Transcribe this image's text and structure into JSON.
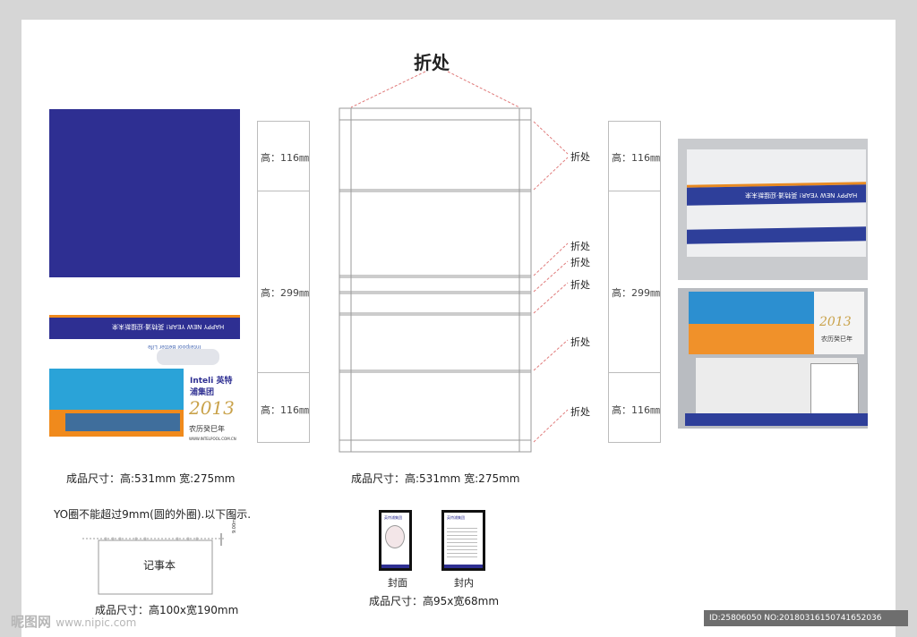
{
  "header": {
    "fold_title": "折处"
  },
  "design_front": {
    "band_text": "HAPPY NEW YEAR! 英特浦·迎接新未来",
    "sub_text": "Intelpool Better Life",
    "brand": "Inteli 英特浦集团",
    "year": "2013",
    "lunar": "农历癸巳年",
    "url": "WWW.INTELPOOL.COM.CN"
  },
  "caption_left": "成品尺寸：高:531mm  宽:275mm",
  "caption_center": "成品尺寸：高:531mm  宽:275mm",
  "segments_left": [
    "高：116㎜",
    "高：299㎜",
    "高：116㎜"
  ],
  "segments_right": [
    "高：116㎜",
    "高：299㎜",
    "高：116㎜"
  ],
  "fold_labels": [
    "折处",
    "折处",
    "折处",
    "折处",
    "折处",
    "折处"
  ],
  "photo1": {
    "label": "HAPPY NEW YEAR! 英特浦·迎接新未来"
  },
  "photo2": {
    "year": "2013",
    "lunar": "农历癸巳年"
  },
  "yo_note": "YO圈不能超过9mm(圆的外圈).以下图示.",
  "notebook": {
    "label": "记事本",
    "dim": "9.00mm",
    "caption": "成品尺寸：高100x宽190mm"
  },
  "thumbs": {
    "cover_label": "封面",
    "inner_label": "封内",
    "caption": "成品尺寸：高95x宽68mm",
    "brand": "英特浦集团"
  },
  "watermark": {
    "site": "昵图网",
    "url": "www.nipic.com"
  },
  "id_bar": "ID:25806050 NO:20180316150741652036",
  "colors": {
    "navy": "#2e2f92",
    "orange": "#f08a1c",
    "cyan": "#2aa3d8"
  }
}
